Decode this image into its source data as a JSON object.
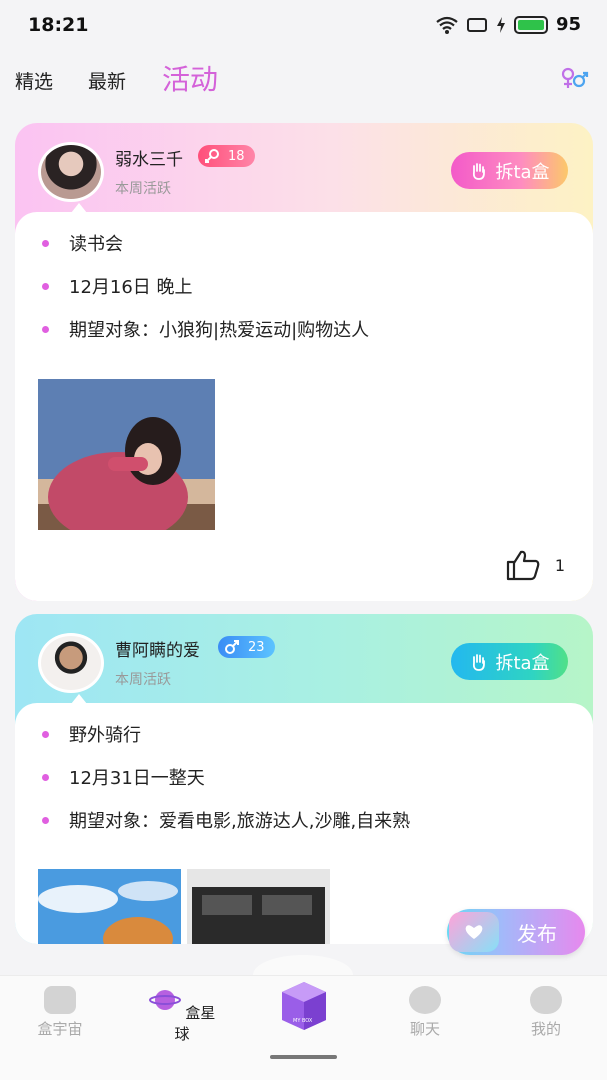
{
  "status_bar": {
    "time": "18:21",
    "battery": "95",
    "battery_level": 0.95
  },
  "tabs": [
    {
      "label": "精选"
    },
    {
      "label": "最新"
    },
    {
      "label": "活动"
    }
  ],
  "icons": {
    "gender_filter": "gender-filter-icon",
    "wave": "wave-hand-icon",
    "like": "thumbs-up-icon",
    "camera": "camera-heart-icon"
  },
  "posts": [
    {
      "username": "弱水三千",
      "age": "18",
      "gender": "female",
      "activity": "本周活跃",
      "unbox_label": "拆ta盒",
      "event": "读书会",
      "time": "12月16日 晚上",
      "expect": "期望对象：小狼狗|热爱运动|购物达人",
      "likes": "1"
    },
    {
      "username": "曹阿瞒的爱",
      "age": "23",
      "gender": "male",
      "activity": "本周活跃",
      "unbox_label": "拆ta盒",
      "event": "野外骑行",
      "time": "12月31日一整天",
      "expect": "期望对象：爱看电影,旅游达人,沙雕,自来熟"
    }
  ],
  "publish_label": "发布",
  "bottom_nav": [
    {
      "label": "盒宇宙"
    },
    {
      "label": "盒星球"
    },
    {
      "label": "MY BOX"
    },
    {
      "label": "聊天"
    },
    {
      "label": "我的"
    }
  ],
  "colors": {
    "accent": "#d462d9",
    "female_badge": "#ff4f7a",
    "male_badge": "#3a8df5"
  }
}
